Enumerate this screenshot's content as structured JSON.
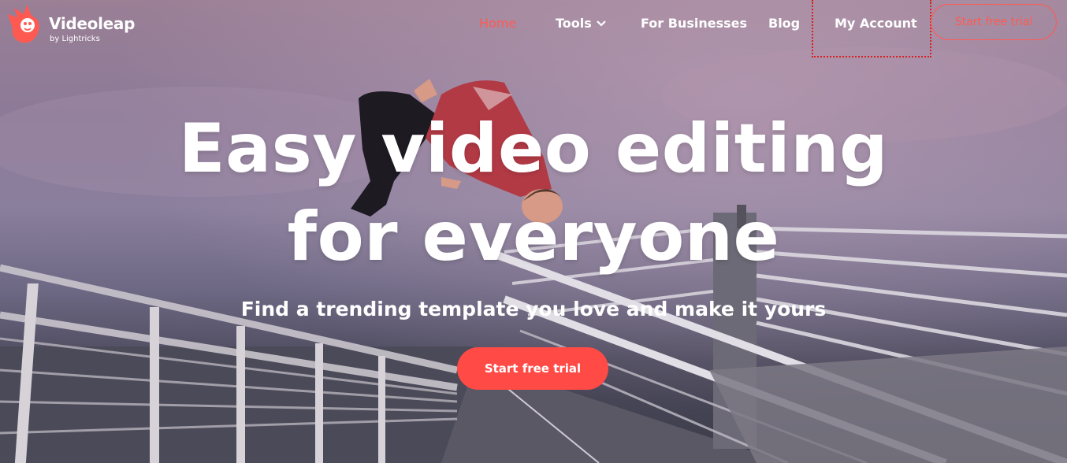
{
  "brand": {
    "name": "Videoleap",
    "tagline": "by Lightricks",
    "accent": "#ff5a52",
    "logo_icon": "bird-logo-icon"
  },
  "nav": {
    "home": "Home",
    "tools": "Tools",
    "businesses": "For Businesses",
    "blog": "Blog",
    "account": "My Account",
    "trial": "Start free trial"
  },
  "hero": {
    "headline_line1": "Easy video editing",
    "headline_line2": "for everyone",
    "subheadline": "Find a trending template you love and make it yours",
    "cta": "Start free trial",
    "cta_color": "#ff4a46"
  }
}
